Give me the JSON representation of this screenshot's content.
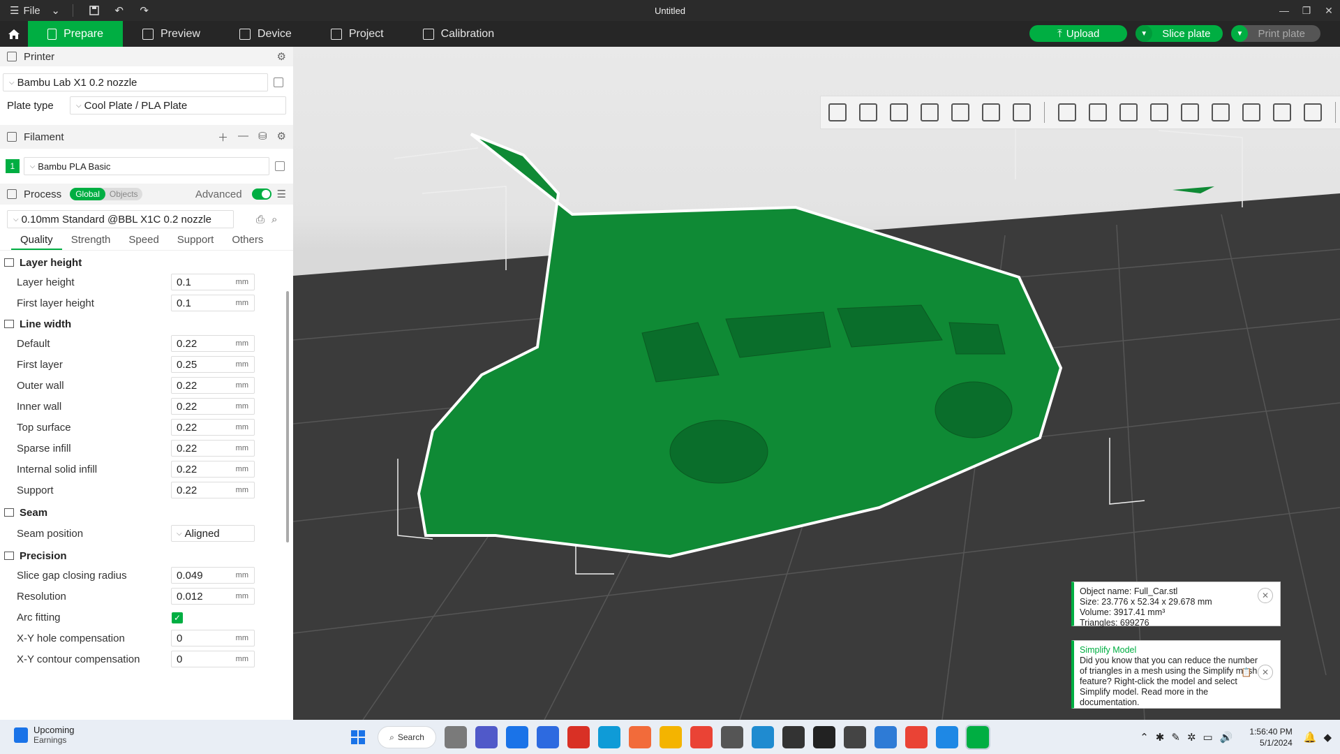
{
  "titlebar": {
    "file_label": "File",
    "title": "Untitled"
  },
  "maintabs": [
    {
      "label": "Prepare",
      "active": true
    },
    {
      "label": "Preview"
    },
    {
      "label": "Device"
    },
    {
      "label": "Project"
    },
    {
      "label": "Calibration"
    }
  ],
  "actions": {
    "upload": "Upload",
    "slice": "Slice plate",
    "print": "Print plate"
  },
  "printer": {
    "section": "Printer",
    "name": "Bambu Lab X1 0.2 nozzle",
    "plate_type_label": "Plate type",
    "plate_type": "Cool Plate / PLA Plate"
  },
  "filament": {
    "section": "Filament",
    "index": "1",
    "name": "Bambu PLA Basic"
  },
  "process": {
    "section": "Process",
    "global": "Global",
    "objects": "Objects",
    "advanced": "Advanced",
    "preset": "0.10mm Standard @BBL X1C 0.2 nozzle",
    "tabs": [
      "Quality",
      "Strength",
      "Speed",
      "Support",
      "Others"
    ]
  },
  "quality": {
    "layer_height": {
      "title": "Layer height",
      "items": [
        {
          "label": "Layer height",
          "value": "0.1",
          "unit": "mm"
        },
        {
          "label": "First layer height",
          "value": "0.1",
          "unit": "mm"
        }
      ]
    },
    "line_width": {
      "title": "Line width",
      "items": [
        {
          "label": "Default",
          "value": "0.22",
          "unit": "mm"
        },
        {
          "label": "First layer",
          "value": "0.25",
          "unit": "mm"
        },
        {
          "label": "Outer wall",
          "value": "0.22",
          "unit": "mm"
        },
        {
          "label": "Inner wall",
          "value": "0.22",
          "unit": "mm"
        },
        {
          "label": "Top surface",
          "value": "0.22",
          "unit": "mm"
        },
        {
          "label": "Sparse infill",
          "value": "0.22",
          "unit": "mm"
        },
        {
          "label": "Internal solid infill",
          "value": "0.22",
          "unit": "mm"
        },
        {
          "label": "Support",
          "value": "0.22",
          "unit": "mm"
        }
      ]
    },
    "seam": {
      "title": "Seam",
      "label": "Seam position",
      "value": "Aligned"
    },
    "precision": {
      "title": "Precision",
      "items": [
        {
          "label": "Slice gap closing radius",
          "value": "0.049",
          "unit": "mm"
        },
        {
          "label": "Resolution",
          "value": "0.012",
          "unit": "mm"
        },
        {
          "label": "Arc fitting",
          "checked": true
        },
        {
          "label": "X-Y hole compensation",
          "value": "0",
          "unit": "mm"
        },
        {
          "label": "X-Y contour compensation",
          "value": "0",
          "unit": "mm"
        }
      ]
    }
  },
  "object_info": {
    "name": "Object name: Full_Car.stl",
    "size": "Size: 23.776 x 52.34 x 29.678 mm",
    "volume": "Volume: 3917.41 mm³",
    "triangles": "Triangles: 699276"
  },
  "simplify": {
    "title": "Simplify Model",
    "lines": [
      "Did you know that you can reduce the number",
      "of triangles in a mesh using the Simplify mesh",
      "feature? Right-click the model and select",
      "Simplify model. Read more in the",
      "documentation."
    ]
  },
  "taskbar": {
    "widget_title": "Upcoming",
    "widget_sub": "Earnings",
    "search": "Search",
    "time": "1:56:40 PM",
    "date": "5/1/2024"
  },
  "colors": {
    "accent": "#00ae42",
    "model": "#0f8a35",
    "bed": "#3a3a3a"
  }
}
